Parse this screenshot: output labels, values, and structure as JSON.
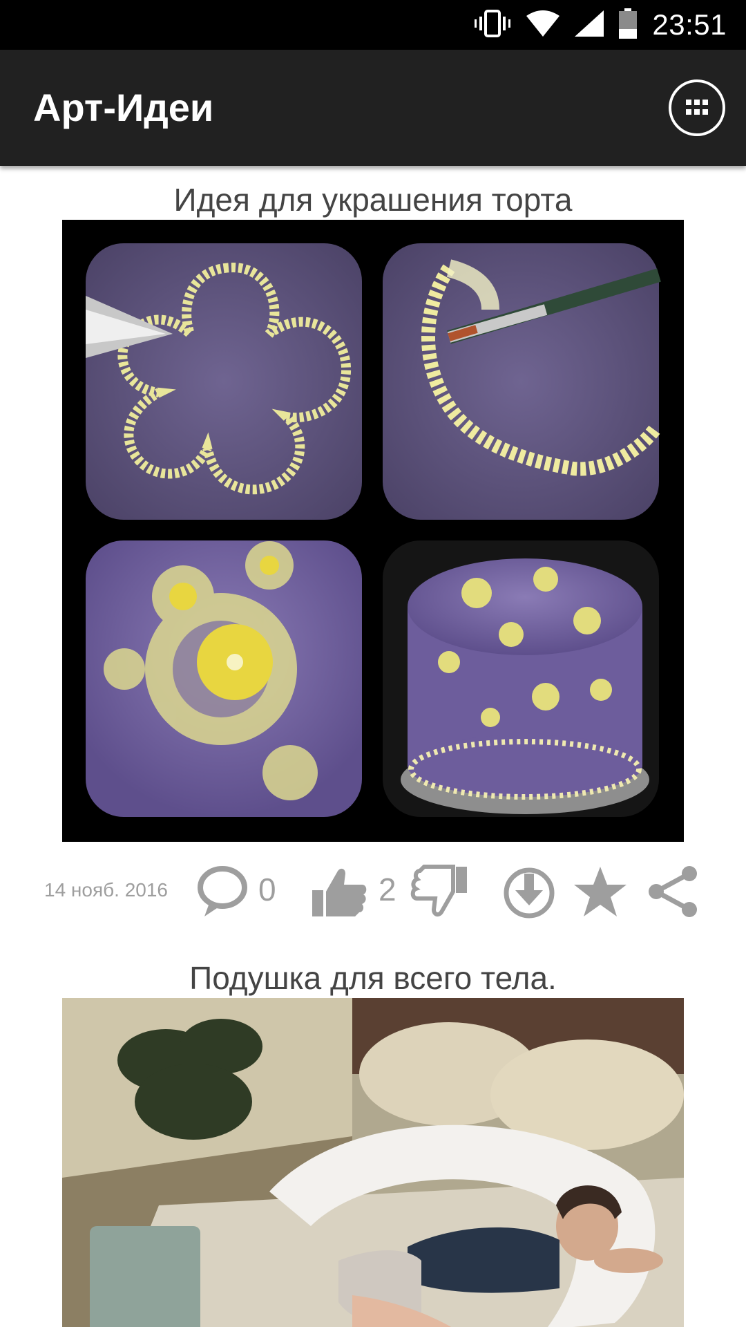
{
  "status_bar": {
    "time": "23:51",
    "icons": [
      "vibrate-icon",
      "wifi-icon",
      "signal-icon",
      "battery-icon"
    ]
  },
  "app_bar": {
    "title": "Арт-Идеи",
    "menu_icon": "grid-menu-icon"
  },
  "posts": [
    {
      "title": "Идея для украшения торта",
      "image": "cake-decoration-collage",
      "date": "14 нояб. 2016",
      "comments": "0",
      "likes": "2",
      "actions": [
        "comment-icon",
        "thumb-up-icon",
        "thumb-down-icon",
        "download-icon",
        "star-icon",
        "share-icon"
      ]
    },
    {
      "title": "Подушка для всего тела.",
      "image": "body-pillow-photo"
    }
  ],
  "colors": {
    "status_bar": "#000000",
    "app_bar": "#212121",
    "icon_gray": "#9e9e9e",
    "text_dark": "#444444"
  }
}
